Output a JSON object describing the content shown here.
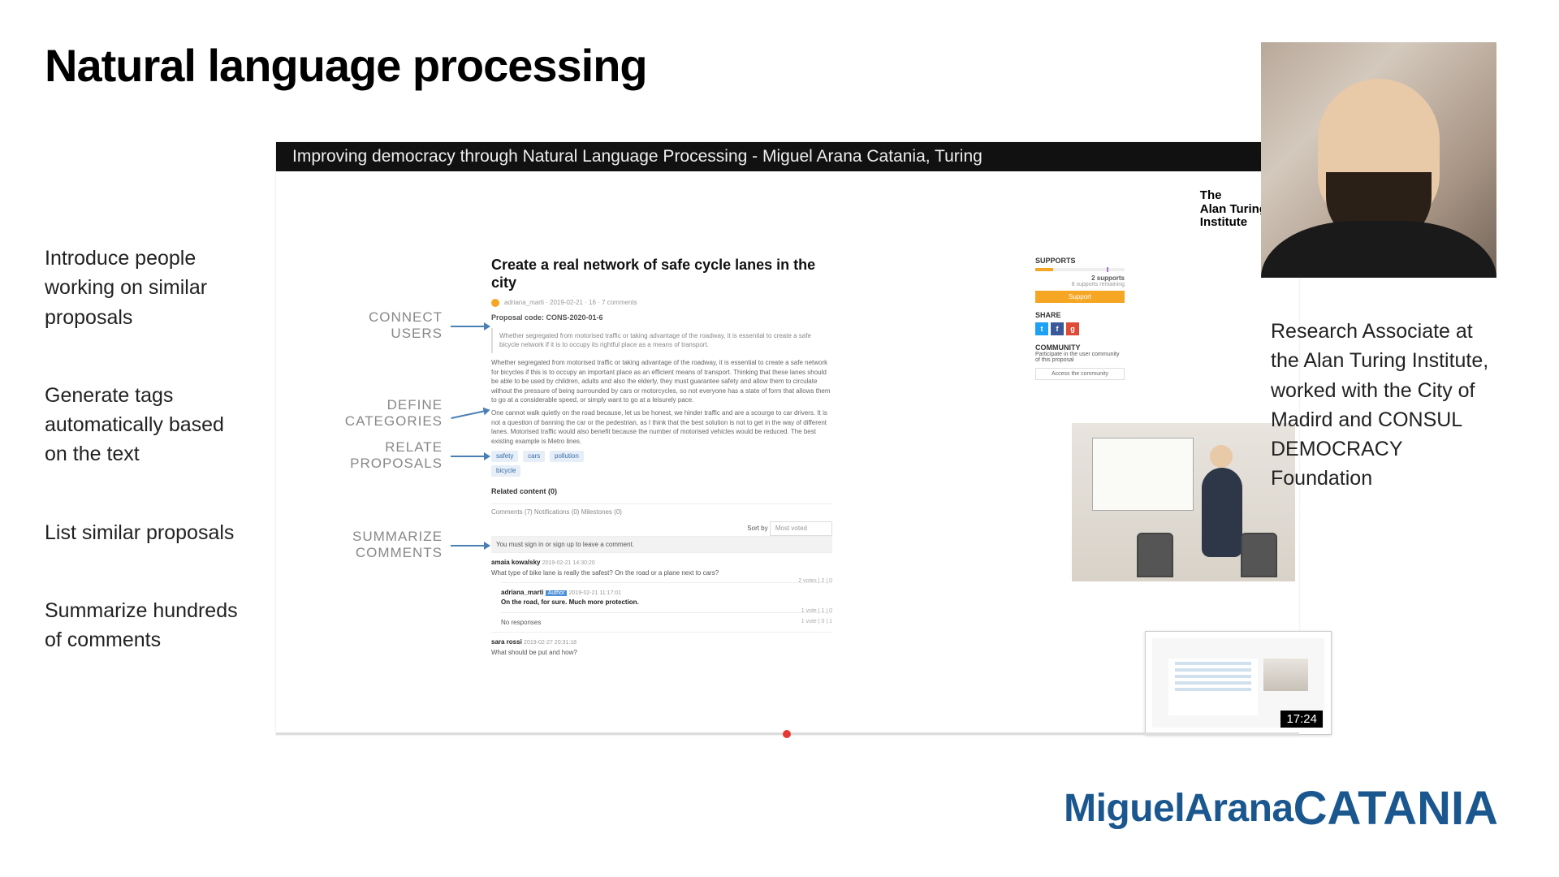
{
  "title": "Natural language processing",
  "bullets": [
    "Introduce people working on similar proposals",
    "Generate tags automatically based on the text",
    "List similar proposals",
    "Summarize hundreds of comments"
  ],
  "video": {
    "title": "Improving democracy through Natural Language Processing - Miguel Arana Catania, Turing",
    "logo_line1": "The",
    "logo_line2": "Alan Turing",
    "logo_line3": "Institute",
    "thumb_time": "17:24"
  },
  "annotations": {
    "connect": "CONNECT USERS",
    "define": "DEFINE CATEGORIES",
    "relate": "RELATE PROPOSALS",
    "summarize": "SUMMARIZE COMMENTS"
  },
  "proposal": {
    "heading": "Create a real network of safe cycle lanes in the city",
    "code": "Proposal code: CONS-2020-01-6",
    "quote": "Whether segregated from motorised traffic or taking advantage of the roadway, it is essential to create a safe bicycle network if it is to occupy its rightful place as a means of transport.",
    "para1": "Whether segregated from motorised traffic or taking advantage of the roadway, it is essential to create a safe network for bicycles if this is to occupy an important place as an efficient means of transport. Thinking that these lanes should be able to be used by children, adults and also the elderly, they must guarantee safety and allow them to circulate without the pressure of being surrounded by cars or motorcycles, so not everyone has a state of form that allows them to go at a considerable speed, or simply want to go at a leisurely pace.",
    "para2": "One cannot walk quietly on the road because, let us be honest, we hinder traffic and are a scourge to car drivers. It is not a question of banning the car or the pedestrian, as I think that the best solution is not to get in the way of different lanes. Motorised traffic would also benefit because the number of motorised vehicles would be reduced. The best existing example is Metro lines.",
    "tags": [
      "safety",
      "cars",
      "pollution",
      "bicycle"
    ],
    "related_label": "Related content (0)",
    "tabs": "Comments (7)   Notifications (0)   Milestones (0)",
    "sort_label": "Sort by",
    "sort_value": "Most voted",
    "prompt": "You must sign in or sign up to leave a comment.",
    "comments": [
      {
        "author": "amaia kowalsky",
        "date": "2019-02-21 14:30:20",
        "text": "What type of bike lane is really the safest? On the road or a plane next to cars?",
        "votes": "2 votes | 2 | 0"
      },
      {
        "author": "adriana_marti",
        "date": "2019-02-21 11:17:01",
        "text": "On the road, for sure. Much more protection.",
        "votes": "1 vote | 1 | 0",
        "badge": "Author"
      },
      {
        "author": "No responses",
        "date": "",
        "text": "",
        "votes": "1 vote | 0 | 1"
      }
    ],
    "last_author": "sara rossi",
    "last_date": "2019-02-27 20:31:18",
    "last_text": "What should be put and how?"
  },
  "supports": {
    "header": "SUPPORTS",
    "count": "2 supports",
    "sub": "8 supports remaining",
    "button": "Support",
    "share_label": "SHARE",
    "community_label": "COMMUNITY",
    "community_text": "Participate in the user community of this proposal",
    "community_button": "Access the community"
  },
  "bio": "Research Associate at the Alan Turing Institute, worked with the City of Madird and CONSUL DEMOCRACY Foundation",
  "footer": {
    "first": "MiguelArana",
    "last": "CATANIA"
  }
}
